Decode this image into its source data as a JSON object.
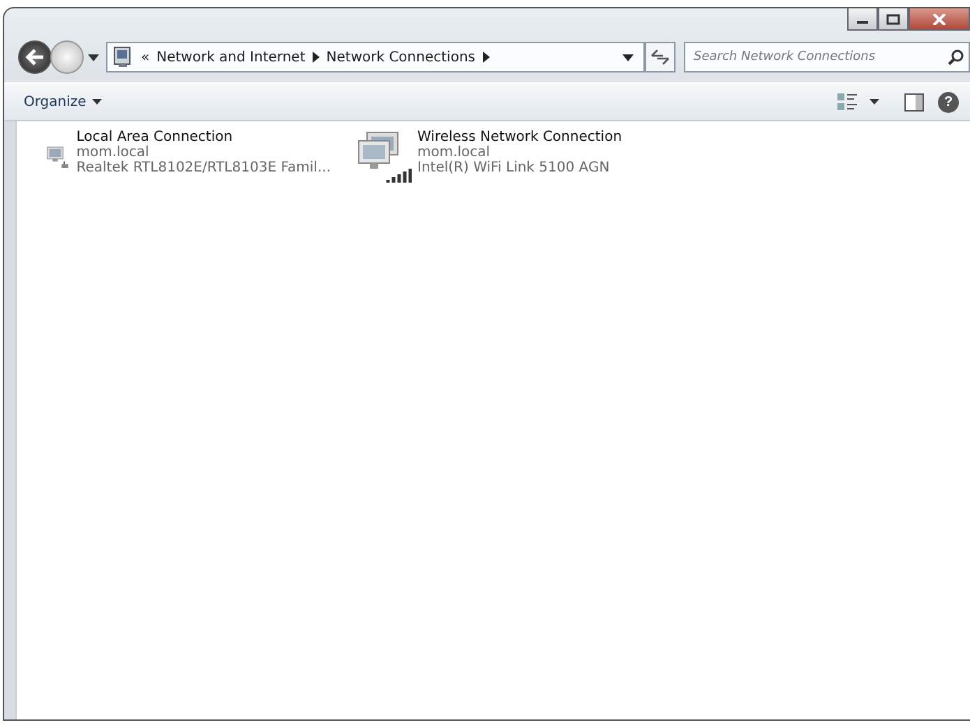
{
  "address_bar": {
    "path": [
      {
        "label": "«",
        "kind": "overflow"
      },
      {
        "label": "Network and Internet",
        "kind": "crumb"
      },
      {
        "label": "Network Connections",
        "kind": "crumb"
      }
    ]
  },
  "search": {
    "placeholder": "Search Network Connections"
  },
  "toolbar": {
    "organize": "Organize",
    "help": "?"
  },
  "connections": [
    {
      "name": "Local Area Connection",
      "status": "mom.local",
      "adapter": "Realtek RTL8102E/RTL8103E Famil...",
      "kind": "wired"
    },
    {
      "name": "Wireless Network Connection",
      "status": "mom.local",
      "adapter": "Intel(R) WiFi Link 5100 AGN",
      "kind": "wireless"
    }
  ]
}
